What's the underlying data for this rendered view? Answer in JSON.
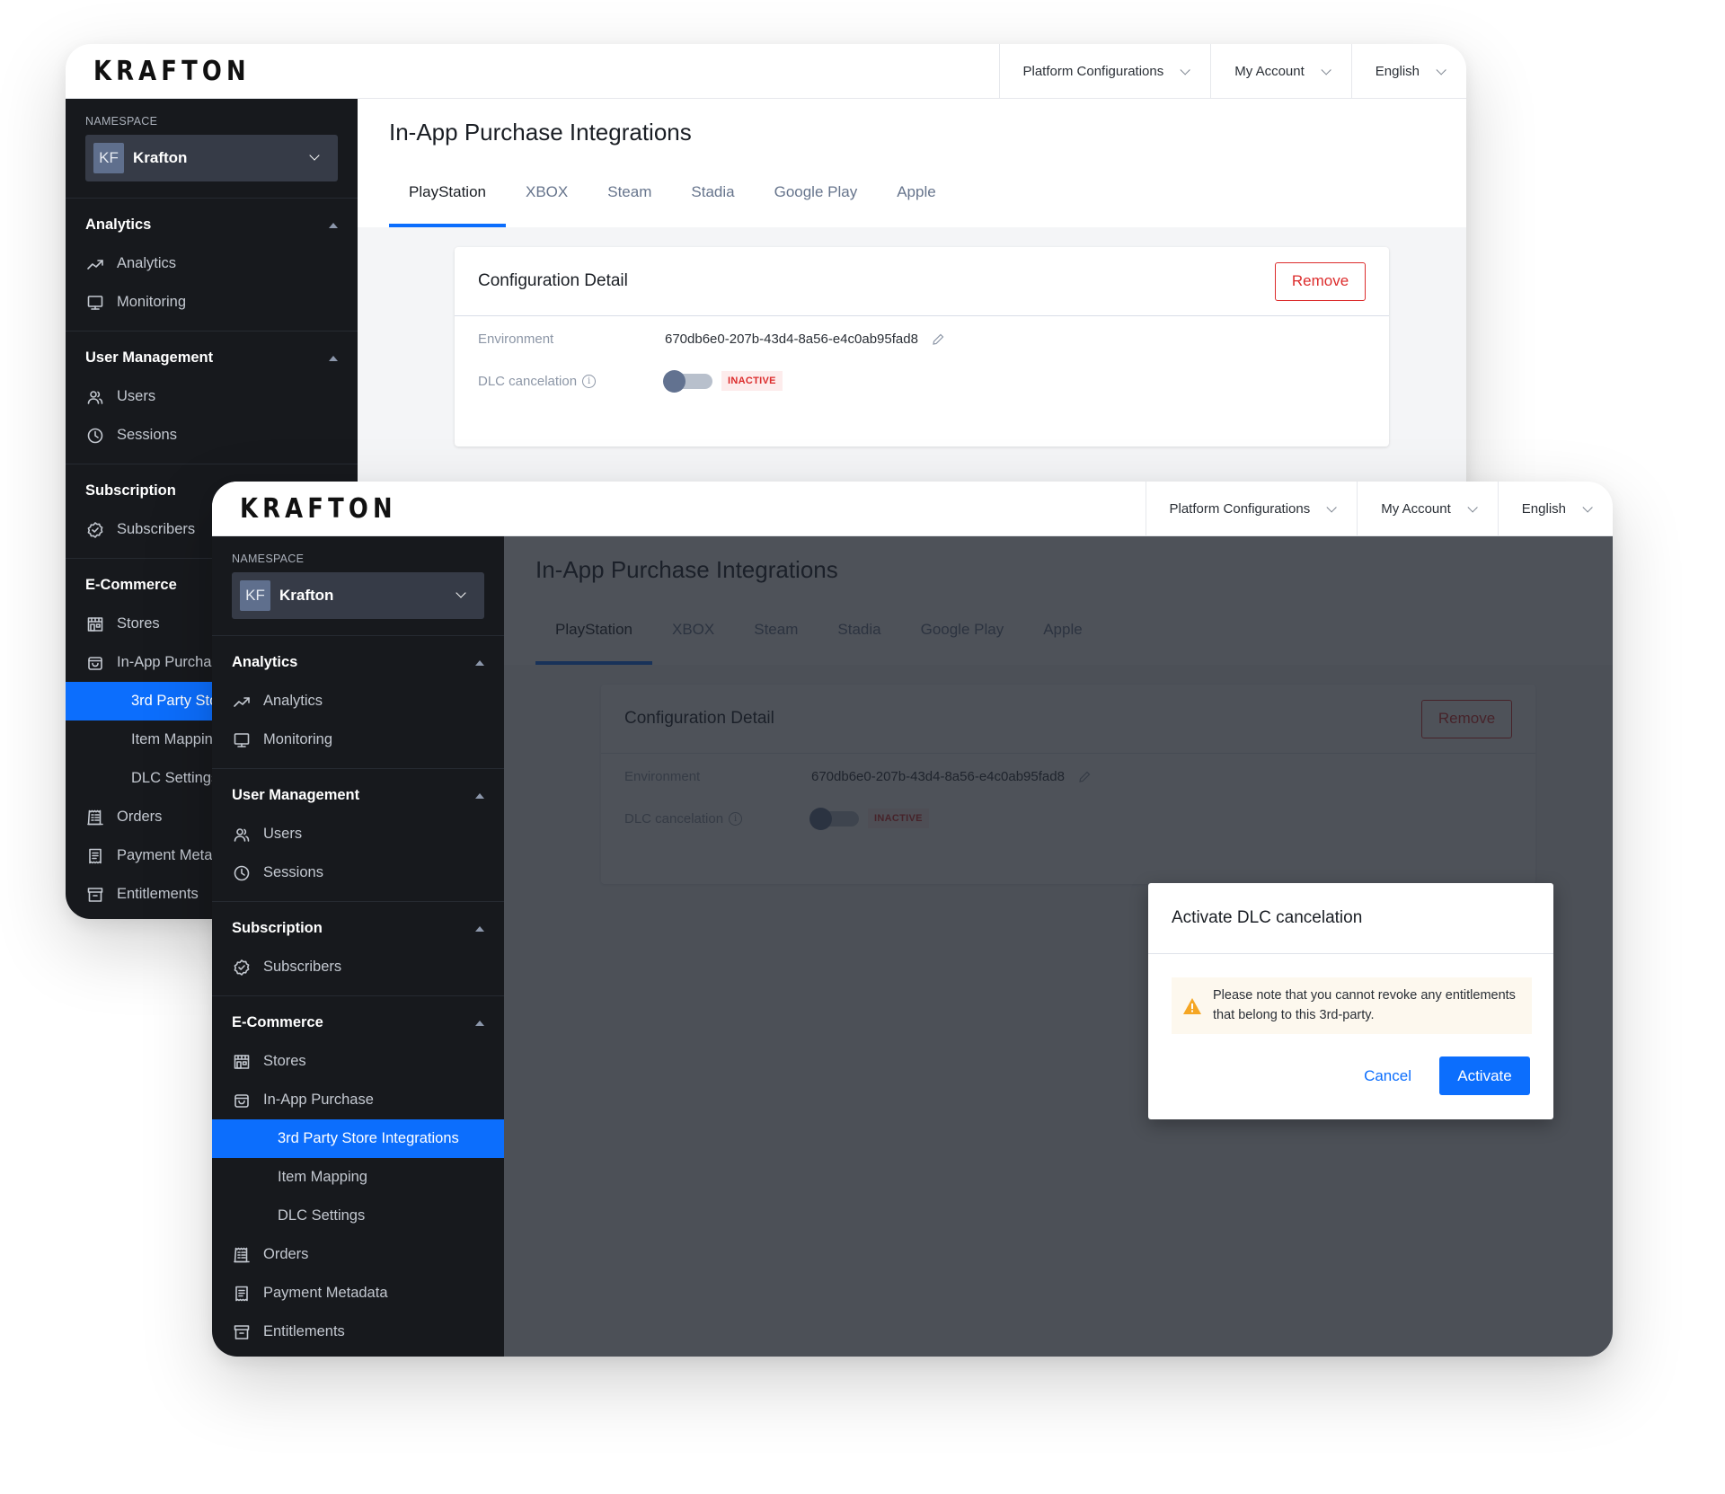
{
  "app": {
    "logo": "KRAFTON"
  },
  "header": {
    "menus": [
      {
        "label": "Platform Configurations"
      },
      {
        "label": "My Account"
      },
      {
        "label": "English"
      }
    ]
  },
  "sidebar": {
    "namespace_label": "NAMESPACE",
    "namespace_badge": "KF",
    "namespace_name": "Krafton",
    "sections": [
      {
        "title": "Analytics",
        "items": [
          {
            "label": "Analytics",
            "icon": "trending-up-icon"
          },
          {
            "label": "Monitoring",
            "icon": "monitor-icon"
          }
        ]
      },
      {
        "title": "User Management",
        "items": [
          {
            "label": "Users",
            "icon": "users-icon"
          },
          {
            "label": "Sessions",
            "icon": "clock-icon"
          }
        ]
      },
      {
        "title": "Subscription",
        "items": [
          {
            "label": "Subscribers",
            "icon": "badge-check-icon"
          }
        ]
      },
      {
        "title": "E-Commerce",
        "items": [
          {
            "label": "Stores",
            "icon": "store-icon"
          },
          {
            "label": "In-App Purchase",
            "icon": "shopping-bag-icon"
          },
          {
            "label": "3rd Party Store Integrations",
            "sub": true,
            "active": true
          },
          {
            "label": "Item Mapping",
            "sub": true
          },
          {
            "label": "DLC Settings",
            "sub": true
          },
          {
            "label": "Orders",
            "icon": "receipt-icon"
          },
          {
            "label": "Payment Metadata",
            "icon": "document-icon"
          },
          {
            "label": "Entitlements",
            "icon": "archive-icon"
          }
        ]
      }
    ]
  },
  "page": {
    "title": "In-App Purchase Integrations",
    "tabs": [
      {
        "label": "PlayStation",
        "active": true
      },
      {
        "label": "XBOX"
      },
      {
        "label": "Steam"
      },
      {
        "label": "Stadia"
      },
      {
        "label": "Google Play"
      },
      {
        "label": "Apple"
      }
    ],
    "card": {
      "title": "Configuration Detail",
      "remove_label": "Remove",
      "environment_label": "Environment",
      "environment_value": "670db6e0-207b-43d4-8a56-e4c0ab95fad8",
      "dlc_label": "DLC cancelation",
      "dlc_status": "INACTIVE",
      "dlc_enabled": false
    }
  },
  "modal": {
    "title": "Activate DLC cancelation",
    "warning": "Please note that you cannot revoke any entitlements that belong to this 3rd-party.",
    "cancel_label": "Cancel",
    "activate_label": "Activate"
  },
  "colors": {
    "accent": "#0c6efd",
    "danger": "#dc2c2c",
    "sidebar_bg": "#17191d",
    "warning": "#f5a623"
  }
}
